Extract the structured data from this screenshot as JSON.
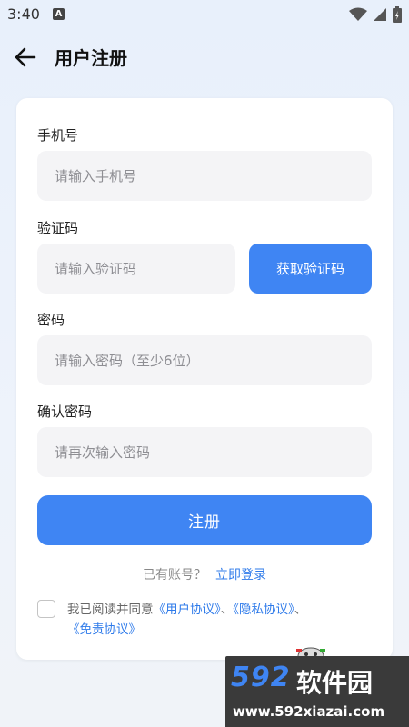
{
  "status_bar": {
    "time": "3:40",
    "notification_letter": "A"
  },
  "header": {
    "title": "用户注册"
  },
  "form": {
    "phone": {
      "label": "手机号",
      "placeholder": "请输入手机号",
      "value": ""
    },
    "code": {
      "label": "验证码",
      "placeholder": "请输入验证码",
      "value": "",
      "button_label": "获取验证码"
    },
    "password": {
      "label": "密码",
      "placeholder": "请输入密码（至少6位）",
      "value": ""
    },
    "confirm": {
      "label": "确认密码",
      "placeholder": "请再次输入密码",
      "value": ""
    },
    "submit_label": "注册"
  },
  "login": {
    "prompt": "已有账号？",
    "link": "立即登录"
  },
  "agreement": {
    "checked": false,
    "prefix": "我已阅读并同意",
    "user_agreement": "《用户协议》",
    "sep1": "、",
    "privacy": "《隐私协议》",
    "sep2": "、",
    "disclaimer": "《免责协议》"
  },
  "watermark": {
    "number": "592",
    "name": "软件园",
    "url": "www.592xiazai.com"
  },
  "colors": {
    "accent": "#3f85f3",
    "link": "#2f7bea",
    "field_bg": "#f4f4f6"
  },
  "icons": [
    "wifi-icon",
    "signal-icon",
    "battery-icon",
    "back-arrow-icon"
  ]
}
